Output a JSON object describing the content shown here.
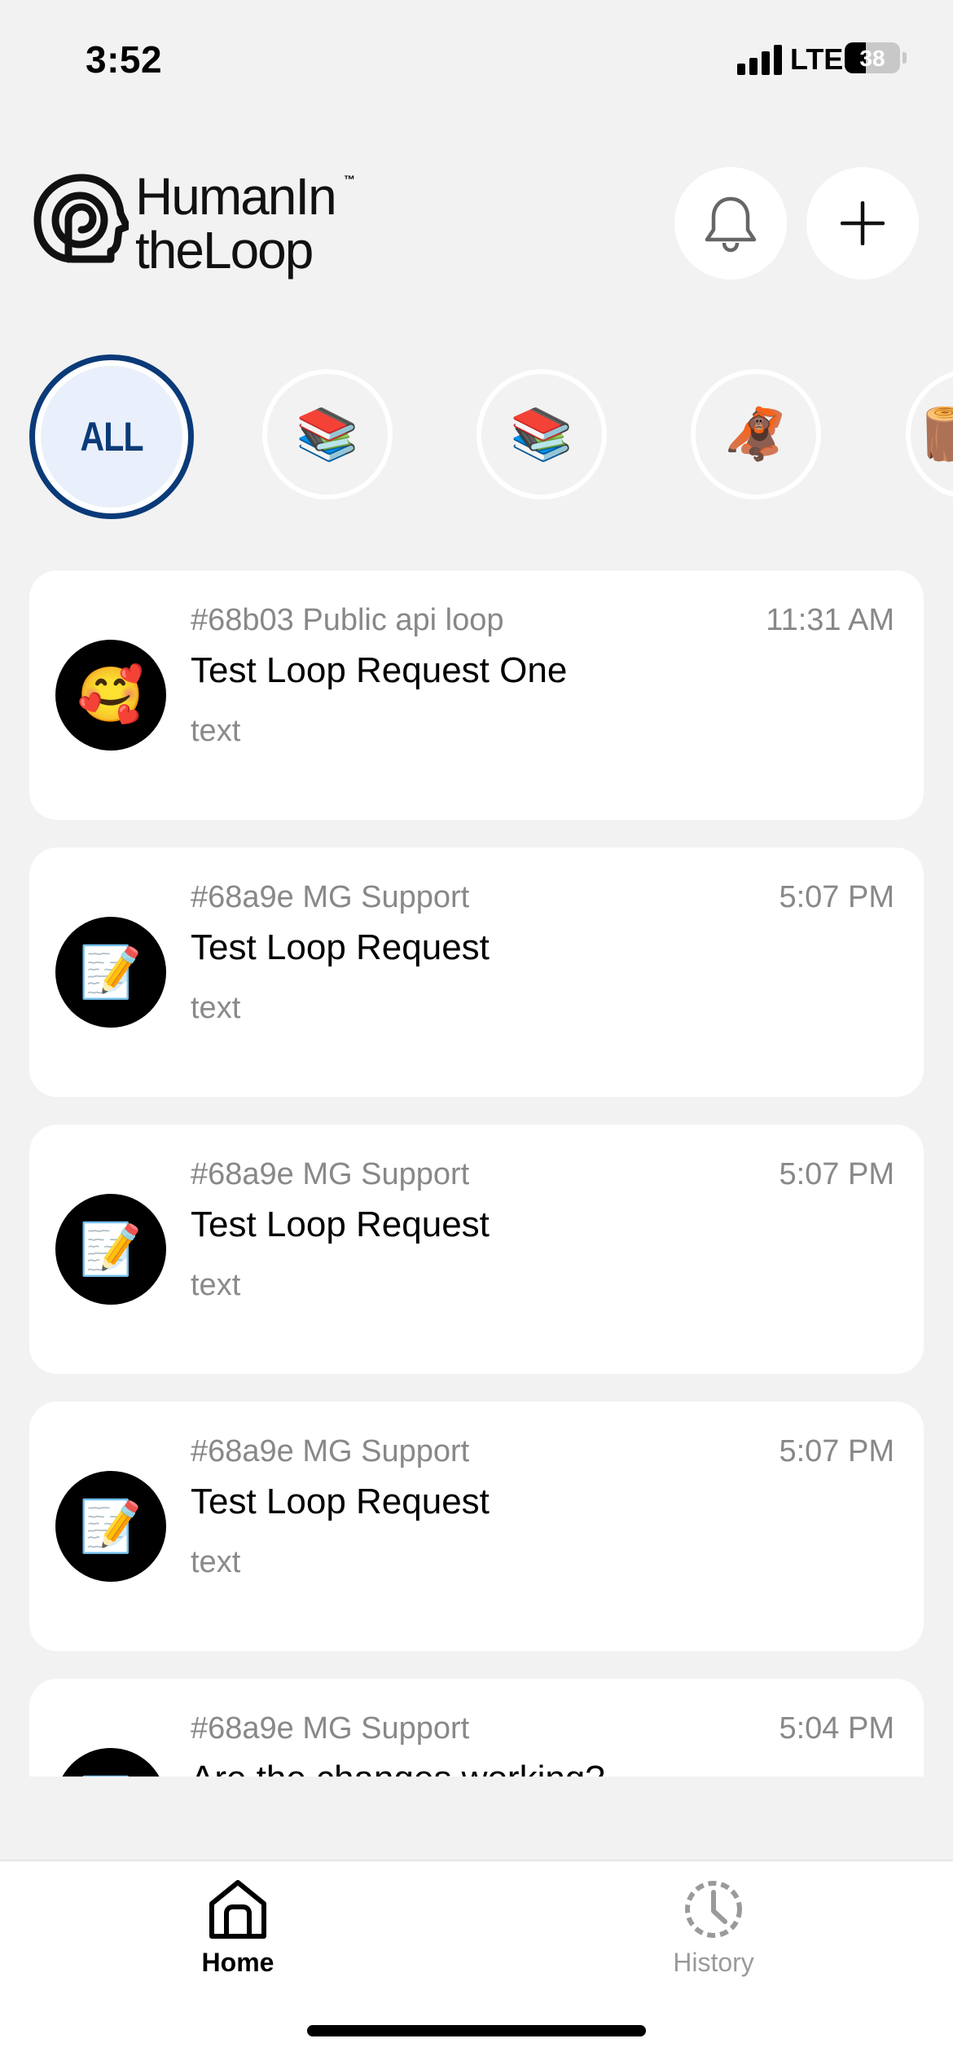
{
  "status_bar": {
    "time": "3:52",
    "network": "LTE",
    "battery": "38",
    "battery_level": 0.38
  },
  "header": {
    "logo_line1": "HumanIn",
    "logo_line2": "theLoop",
    "logo_tm": "™",
    "notifications_icon": "bell-icon",
    "add_icon": "plus-icon"
  },
  "filters": [
    {
      "label": "ALL",
      "selected": true
    },
    {
      "emoji": "📚",
      "selected": false
    },
    {
      "emoji": "📚",
      "selected": false
    },
    {
      "emoji": "🦧",
      "selected": false
    },
    {
      "emoji": "🪵",
      "selected": false
    }
  ],
  "requests": [
    {
      "emoji": "🥰",
      "meta": "#68b03 Public api loop",
      "time": "11:31 AM",
      "title": "Test Loop Request One",
      "body": "text"
    },
    {
      "emoji": "📝",
      "meta": "#68a9e MG Support",
      "time": "5:07 PM",
      "title": "Test Loop Request",
      "body": "text"
    },
    {
      "emoji": "📝",
      "meta": "#68a9e MG Support",
      "time": "5:07 PM",
      "title": "Test Loop Request",
      "body": "text"
    },
    {
      "emoji": "📝",
      "meta": "#68a9e MG Support",
      "time": "5:07 PM",
      "title": "Test Loop Request",
      "body": "text"
    },
    {
      "emoji": "📝",
      "meta": "#68a9e MG Support",
      "time": "5:04 PM",
      "title": "Are the changes working?",
      "body": ""
    }
  ],
  "tabbar": {
    "home_label": "Home",
    "history_label": "History",
    "active": "home",
    "colors": {
      "active": "#000000",
      "inactive": "#9a9a9a"
    }
  }
}
